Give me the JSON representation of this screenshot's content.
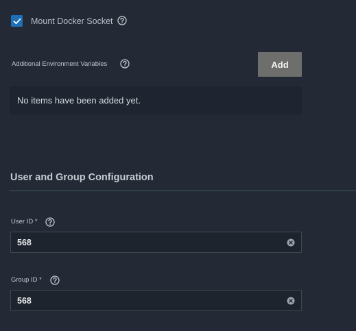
{
  "mount_docker_socket": {
    "label": "Mount Docker Socket",
    "checked": true
  },
  "additional_env": {
    "label": "Additional Environment Variables",
    "add_button_label": "Add",
    "empty_message": "No items have been added yet."
  },
  "user_group_section": {
    "title": "User and Group Configuration"
  },
  "user_id": {
    "label": "User ID *",
    "value": "568"
  },
  "group_id": {
    "label": "Group ID *",
    "value": "568"
  },
  "colors": {
    "background": "#232a35",
    "checkbox": "#1f6fb8",
    "add_button": "#6e6e6c",
    "divider": "#3e5663"
  },
  "icons": {
    "checkbox": "checkmark-icon",
    "help": "question-circle-icon",
    "clear": "clear-x-circle-icon"
  }
}
